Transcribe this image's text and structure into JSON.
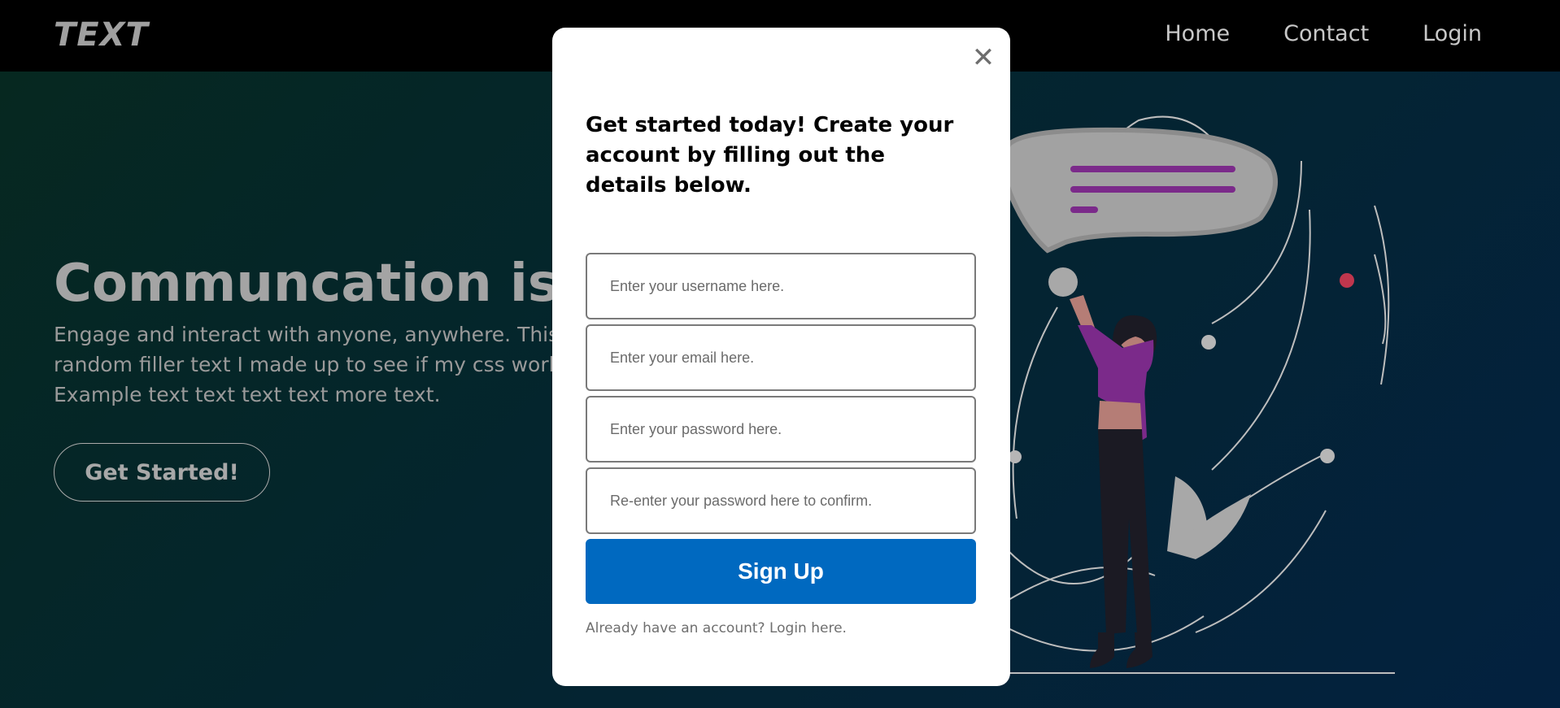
{
  "nav": {
    "logo": "TEXT",
    "links": [
      "Home",
      "Contact",
      "Login"
    ]
  },
  "hero": {
    "title": "Communcation is th",
    "subtitle": "Engage and interact with anyone, anywhere. This is random filler text I made up to see if my css works. Example text text text text more text.",
    "cta": "Get Started!"
  },
  "modal": {
    "close": "✕",
    "heading": "Get started today! Create your account by filling out the details below.",
    "fields": {
      "username_placeholder": "Enter your username here.",
      "email_placeholder": "Enter your email here.",
      "password_placeholder": "Enter your password here.",
      "confirm_placeholder": "Re-enter your password here to confirm."
    },
    "submit": "Sign Up",
    "login_prompt": "Already have an account?",
    "login_link": "Login here."
  },
  "colors": {
    "primary_button": "#0069c0",
    "accent_purple": "#7b2a8a",
    "nav_background": "#000000"
  }
}
